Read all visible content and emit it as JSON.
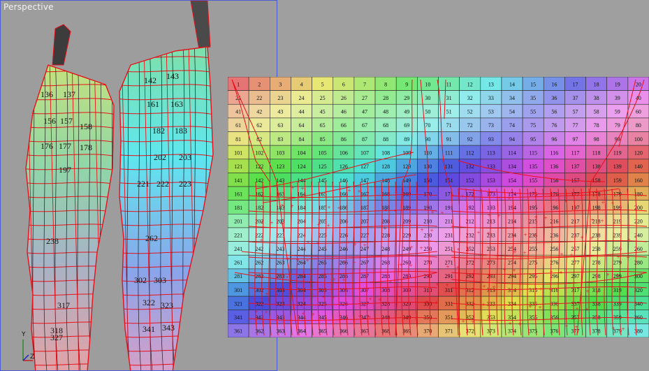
{
  "viewport": {
    "label": "Perspective"
  },
  "axis": {
    "x": "X",
    "y": "Y",
    "z": "Z"
  },
  "model_labels": {
    "left_leg": [
      "136",
      "137",
      "156",
      "157",
      "158",
      "176",
      "177",
      "178",
      "197",
      "238",
      "317",
      "318",
      "327"
    ],
    "right_leg": [
      "142",
      "143",
      "161",
      "163",
      "182",
      "183",
      "202",
      "203",
      "221",
      "222",
      "223",
      "262",
      "302",
      "303",
      "322",
      "323",
      "341",
      "343"
    ]
  },
  "uv_grid": {
    "cols": 20,
    "rows": 19,
    "start": 1
  },
  "colors": {
    "wire": "#e8101a",
    "grid": "#222222",
    "viewport_border": "#4a5cd0"
  }
}
